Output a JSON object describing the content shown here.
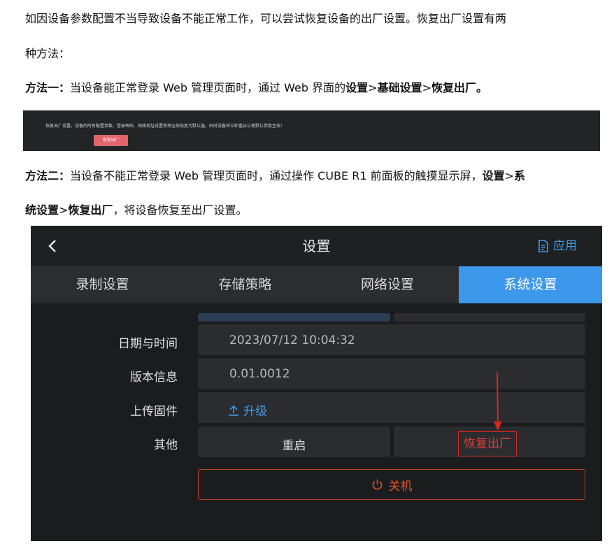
{
  "doc": {
    "line1": "如因设备参数配置不当导致设备不能正常工作，可以尝试恢复设备的出厂设置。恢复出厂设置有两",
    "line2": "种方法：",
    "method1": {
      "label": "方法一：",
      "text": "当设备能正常登录 Web 管理页面时，通过 Web 界面的",
      "path_settings": "设置",
      "sep1": ">",
      "path_basic": "基础设置",
      "sep2": ">",
      "path_reset": "恢复出厂",
      "end": "。"
    },
    "method2": {
      "label": "方法二：",
      "text": "当设备不能正常登录 Web 管理页面时，通过操作 CUBE R1 前面板的触摸显示屏，",
      "path_settings": "设置",
      "sep1": ">",
      "path_sys_a": "系",
      "path_sys_b": "统设置",
      "sep2": ">",
      "path_reset": "恢复出厂",
      "end": "，将设备恢复至出厂设置。"
    }
  },
  "web_screenshot": {
    "note": "恢复出厂设置。设备的所有配置参数、登录密码、网络地址设置等将全部恢复为默认值。同时设备将立即重启以使默认参数生效!",
    "reset_button": "恢复出厂"
  },
  "device": {
    "title": "设置",
    "apply": "应用",
    "tabs": [
      "录制设置",
      "存储策略",
      "网络设置",
      "系统设置"
    ],
    "active_tab": 3,
    "rows": {
      "datetime": {
        "label": "日期与时间",
        "value": "2023/07/12 10:04:32"
      },
      "version": {
        "label": "版本信息",
        "value": "0.01.0012"
      },
      "firmware": {
        "label": "上传固件",
        "value": "升级"
      },
      "other": {
        "label": "其他",
        "restart": "重启",
        "factory_reset": "恢复出厂"
      }
    },
    "shutdown": "关机",
    "colors": {
      "accent": "#3d97ea",
      "danger": "#e0552a",
      "highlight": "#d5281f"
    }
  }
}
